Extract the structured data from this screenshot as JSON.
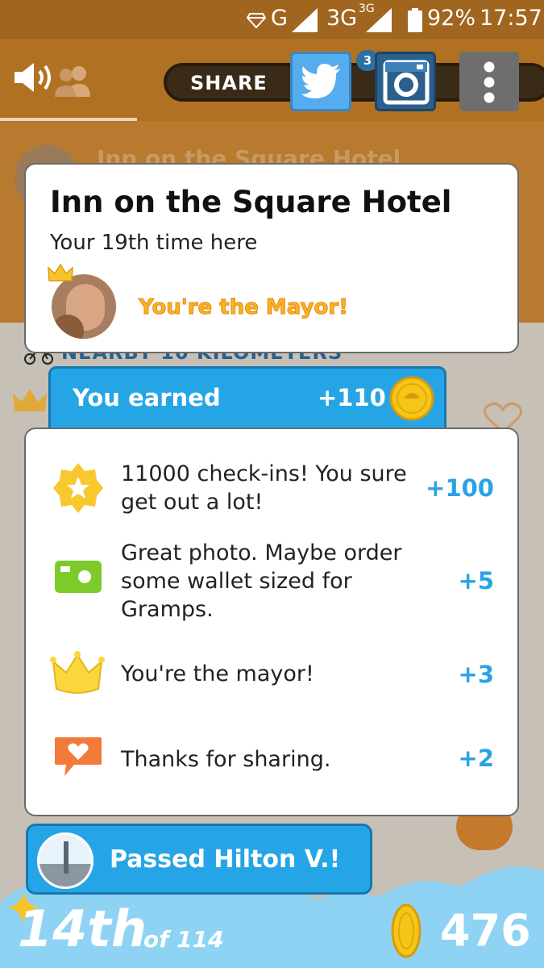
{
  "status_bar": {
    "network": "G",
    "network2": "3G",
    "network2_sup": "3G",
    "battery": "92%",
    "time": "17:57"
  },
  "toolbar": {
    "share_label": "SHARE",
    "notification_badge": "3",
    "icons": [
      "speaker-icon",
      "friends-icon",
      "twitter-icon",
      "instagram-icon",
      "more-vertical-icon"
    ]
  },
  "hotel_card": {
    "title": "Inn on the Square Hotel",
    "visit_text": "Your 19th time here",
    "mayor_text": "You're the Mayor!"
  },
  "background": {
    "section_heading": "NEARBY 10 KILOMETERS",
    "venue_title": "Inn on the Square Hotel"
  },
  "earned": {
    "label": "You earned",
    "amount": "+110"
  },
  "rewards": [
    {
      "icon": "star-badge-icon",
      "text": "11000 check-ins! You sure get out a lot!",
      "points": "+100"
    },
    {
      "icon": "camera-icon",
      "text": "Great photo. Maybe order some wallet sized for Gramps.",
      "points": "+5"
    },
    {
      "icon": "crown-icon",
      "text": "You're the mayor!",
      "points": "+3"
    },
    {
      "icon": "heart-speech-icon",
      "text": "Thanks for sharing.",
      "points": "+2"
    }
  ],
  "passed": {
    "label": "Passed Hilton V.!"
  },
  "leaderboard": {
    "rank": "14th",
    "of_total": "of 114",
    "coins": "476"
  },
  "colors": {
    "accent_blue": "#26a5e6",
    "points_blue": "#2aa3e3",
    "mayor_orange": "#f7b320",
    "app_bar_brown": "#b07222",
    "cloud_blue": "#8fd3f4"
  }
}
